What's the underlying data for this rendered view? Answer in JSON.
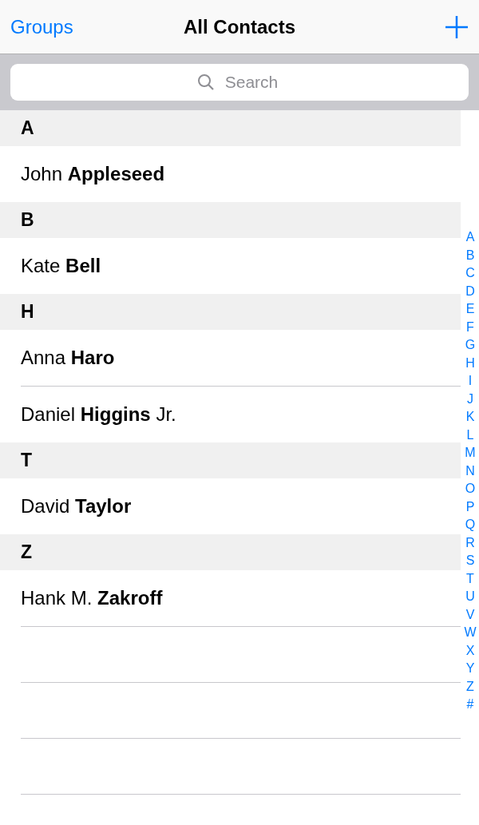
{
  "nav_bar": {
    "back_link": "Groups",
    "title": "All Contacts"
  },
  "search": {
    "placeholder": "Search"
  },
  "sections": [
    {
      "header": "A",
      "contacts": [
        "John **Appleseed**"
      ]
    },
    {
      "header": "B",
      "contacts": [
        "Kate **Bell**"
      ]
    },
    {
      "header": "H",
      "contacts": [
        "Anna **Haro**",
        "Daniel **Higgins** Jr."
      ]
    },
    {
      "header": "T",
      "contacts": [
        "David **Taylor**"
      ]
    },
    {
      "header": "Z",
      "contacts": [
        "Hank M. **Zakroff**"
      ]
    }
  ],
  "index": [
    "A",
    "B",
    "C",
    "D",
    "E",
    "F",
    "G",
    "H",
    "I",
    "J",
    "K",
    "L",
    "M",
    "N",
    "O",
    "P",
    "Q",
    "R",
    "S",
    "T",
    "U",
    "V",
    "W",
    "X",
    "Y",
    "Z",
    "#"
  ]
}
